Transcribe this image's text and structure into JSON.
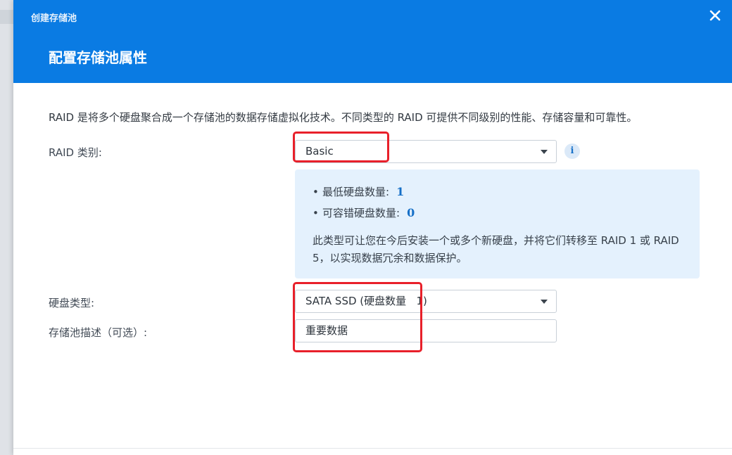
{
  "window": {
    "title": "创建存储池",
    "step_title": "配置存储池属性"
  },
  "description": "RAID 是将多个硬盘聚合成一个存储池的数据存储虚拟化技术。不同类型的 RAID 可提供不同级别的性能、存储容量和可靠性。",
  "raid_type": {
    "label": "RAID 类别:",
    "value": "Basic"
  },
  "raid_info": {
    "min_disks_label": "最低硬盘数量:",
    "min_disks_value": "1",
    "fault_tolerance_label": "可容错硬盘数量:",
    "fault_tolerance_value": "0",
    "note": "此类型可让您在今后安装一个或多个新硬盘，并将它们转移至 RAID 1 或 RAID 5，以实现数据冗余和数据保护。"
  },
  "disk_type": {
    "label": "硬盘类型:",
    "value": "SATA SSD (硬盘数量   1)"
  },
  "pool_description": {
    "label": "存储池描述（可选）:",
    "value": "重要数据"
  },
  "icons": {
    "close": "close-icon",
    "info": "info-icon",
    "dropdown": "chevron-down-icon"
  },
  "colors": {
    "header_bg": "#0a7be3",
    "info_panel_bg": "#e4f1fd",
    "highlight": "#e8202a",
    "accent_number": "#156fc7"
  }
}
